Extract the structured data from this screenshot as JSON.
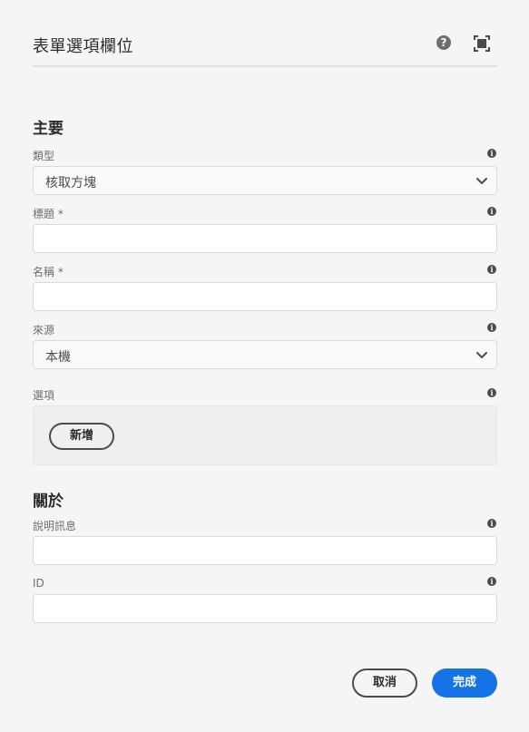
{
  "dialog": {
    "title": "表單選項欄位",
    "help_icon": "help-circle-icon",
    "fullscreen_icon": "fullscreen-icon"
  },
  "main_section": {
    "title": "主要",
    "type": {
      "label": "類型",
      "value": "核取方塊"
    },
    "title_field": {
      "label": "標題 *",
      "value": ""
    },
    "name_field": {
      "label": "名稱 *",
      "value": ""
    },
    "source": {
      "label": "來源",
      "value": "本機"
    },
    "options": {
      "label": "選項",
      "add_label": "新增"
    }
  },
  "about_section": {
    "title": "關於",
    "description": {
      "label": "說明訊息",
      "value": ""
    },
    "id": {
      "label": "ID",
      "value": ""
    }
  },
  "footer": {
    "cancel_label": "取消",
    "done_label": "完成"
  },
  "colors": {
    "accent": "#1473e6",
    "background": "#f5f5f5"
  },
  "info_icon": "i"
}
